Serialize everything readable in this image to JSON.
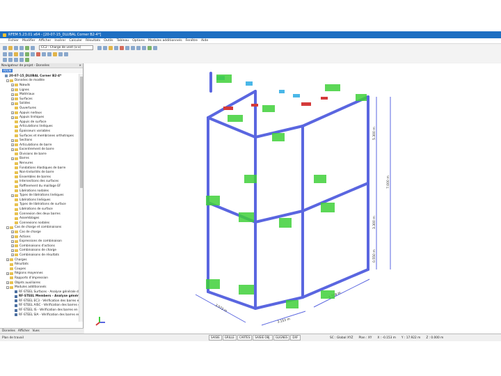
{
  "window_title": "RFEM 5.23.01 x64 - [20-07-15_DLUBAL Corner B2-4*]",
  "menu": [
    "Fichier",
    "Modifier",
    "Afficher",
    "Insérer",
    "Calculer",
    "Résultats",
    "Outils",
    "Tableau",
    "Options",
    "Modules additionnels",
    "Fenêtre",
    "Aide"
  ],
  "toolbar": {
    "load_case": "CC2 : Charge de vent (x-x)"
  },
  "navigator": {
    "title": "Navigateur de projet - Données",
    "tab": "RFEM",
    "tree": [
      {
        "label": "20-07-15_DLUBAL Corner B2-4*",
        "level": 0,
        "icon": "root",
        "bold": true
      },
      {
        "label": "Données de modèle",
        "level": 1,
        "icon": "folder",
        "exp": "−"
      },
      {
        "label": "Nœuds",
        "level": 2,
        "icon": "folder",
        "exp": "+"
      },
      {
        "label": "Lignes",
        "level": 2,
        "icon": "folder",
        "exp": "+"
      },
      {
        "label": "Matériaux",
        "level": 2,
        "icon": "folder",
        "exp": "+"
      },
      {
        "label": "Surfaces",
        "level": 2,
        "icon": "folder",
        "exp": "+"
      },
      {
        "label": "Solides",
        "level": 2,
        "icon": "folder",
        "exp": "+"
      },
      {
        "label": "Ouvertures",
        "level": 2,
        "icon": "folder"
      },
      {
        "label": "Appuis nodaux",
        "level": 2,
        "icon": "folder",
        "exp": "+"
      },
      {
        "label": "Appuis linéiques",
        "level": 2,
        "icon": "folder",
        "exp": "+"
      },
      {
        "label": "Appuis de surface",
        "level": 2,
        "icon": "folder"
      },
      {
        "label": "Articulations linéiques",
        "level": 2,
        "icon": "folder"
      },
      {
        "label": "Épaisseurs variables",
        "level": 2,
        "icon": "folder"
      },
      {
        "label": "Surfaces et membranes orthotropes",
        "level": 2,
        "icon": "folder"
      },
      {
        "label": "Sections",
        "level": 2,
        "icon": "folder",
        "exp": "+"
      },
      {
        "label": "Articulations de barre",
        "level": 2,
        "icon": "folder",
        "exp": "+"
      },
      {
        "label": "Excentrement de barre",
        "level": 2,
        "icon": "folder",
        "exp": "+"
      },
      {
        "label": "Divisions de barre",
        "level": 2,
        "icon": "folder"
      },
      {
        "label": "Barres",
        "level": 2,
        "icon": "folder",
        "exp": "+"
      },
      {
        "label": "Nervures",
        "level": 2,
        "icon": "folder"
      },
      {
        "label": "Fondations élastiques de barre",
        "level": 2,
        "icon": "folder"
      },
      {
        "label": "Non-linéarités de barre",
        "level": 2,
        "icon": "folder"
      },
      {
        "label": "Ensembles de barres",
        "level": 2,
        "icon": "folder"
      },
      {
        "label": "Intersections des surfaces",
        "level": 2,
        "icon": "folder"
      },
      {
        "label": "Raffinement du maillage EF",
        "level": 2,
        "icon": "folder"
      },
      {
        "label": "Libérations nodales",
        "level": 2,
        "icon": "folder"
      },
      {
        "label": "Types de libérations linéiques",
        "level": 2,
        "icon": "folder",
        "exp": "+"
      },
      {
        "label": "Libérations linéiques",
        "level": 2,
        "icon": "folder"
      },
      {
        "label": "Types de libérations de surface",
        "level": 2,
        "icon": "folder"
      },
      {
        "label": "Libérations de surface",
        "level": 2,
        "icon": "folder"
      },
      {
        "label": "Connexion des deux barres",
        "level": 2,
        "icon": "folder"
      },
      {
        "label": "Assemblages",
        "level": 2,
        "icon": "folder"
      },
      {
        "label": "Connexions nodales",
        "level": 2,
        "icon": "folder"
      },
      {
        "label": "Cas de charge et combinaisons",
        "level": 1,
        "icon": "folder",
        "exp": "−"
      },
      {
        "label": "Cas de charge",
        "level": 2,
        "icon": "folder",
        "exp": "+"
      },
      {
        "label": "Actions",
        "level": 2,
        "icon": "folder",
        "exp": "+"
      },
      {
        "label": "Expressions de combinaison",
        "level": 2,
        "icon": "folder",
        "exp": "+"
      },
      {
        "label": "Combinaisons d'actions",
        "level": 2,
        "icon": "folder",
        "exp": "+"
      },
      {
        "label": "Combinaisons de charge",
        "level": 2,
        "icon": "folder",
        "exp": "+"
      },
      {
        "label": "Combinaisons de résultats",
        "level": 2,
        "icon": "folder",
        "exp": "+"
      },
      {
        "label": "Charges",
        "level": 1,
        "icon": "folder",
        "exp": "+"
      },
      {
        "label": "Résultats",
        "level": 1,
        "icon": "folder"
      },
      {
        "label": "Coupes",
        "level": 1,
        "icon": "folder"
      },
      {
        "label": "Régions moyennes",
        "level": 1,
        "icon": "folder",
        "exp": "+"
      },
      {
        "label": "Rapports d'impression",
        "level": 1,
        "icon": "folder"
      },
      {
        "label": "Objets auxiliaires",
        "level": 1,
        "icon": "folder",
        "exp": "+"
      },
      {
        "label": "Modules additionnels",
        "level": 1,
        "icon": "folder",
        "exp": "−"
      },
      {
        "label": "RF-STEEL Surfaces - Analyse générale de",
        "level": 2,
        "icon": "module"
      },
      {
        "label": "RF-STEEL Members - Analyse générale",
        "level": 2,
        "icon": "module",
        "bold": true
      },
      {
        "label": "RF-STEEL EC3 - Vérification des barres er",
        "level": 2,
        "icon": "module"
      },
      {
        "label": "RF-STEEL AISC - Vérification des barres er",
        "level": 2,
        "icon": "module"
      },
      {
        "label": "RF-STEEL IS - Vérification des barres en",
        "level": 2,
        "icon": "module"
      },
      {
        "label": "RF-STEEL SIA - Vérification des barres en",
        "level": 2,
        "icon": "module"
      }
    ],
    "bottom_tabs": [
      "Données",
      "Afficher",
      "Vues"
    ]
  },
  "dimensions": {
    "d_top": "5.300 m",
    "d_total": "7.000 m",
    "d_mid": "3.300 m",
    "d_bottom": "0.550 m",
    "d_left": "3.573 m",
    "d_front_left": "3.153 m",
    "d_front_right": "3.708 m"
  },
  "status": {
    "left": "Plan de travail",
    "buttons": [
      "SAISIE",
      "GRILLE",
      "CARTES",
      "SAISIE OBJ.",
      "GLIGNES",
      "DXF"
    ],
    "sc": "SC : Global XYZ",
    "plane": "Plan : XY",
    "x": "X : -0.153 m",
    "y": "Y : 17.922 m",
    "z": "Z : 0.000 m"
  },
  "colors": {
    "titlebar": "#1e6fc2",
    "frame": "#5a66e0",
    "panel": "#3fd03a",
    "load": "#4ab7e8",
    "support": "#d43a3a"
  }
}
